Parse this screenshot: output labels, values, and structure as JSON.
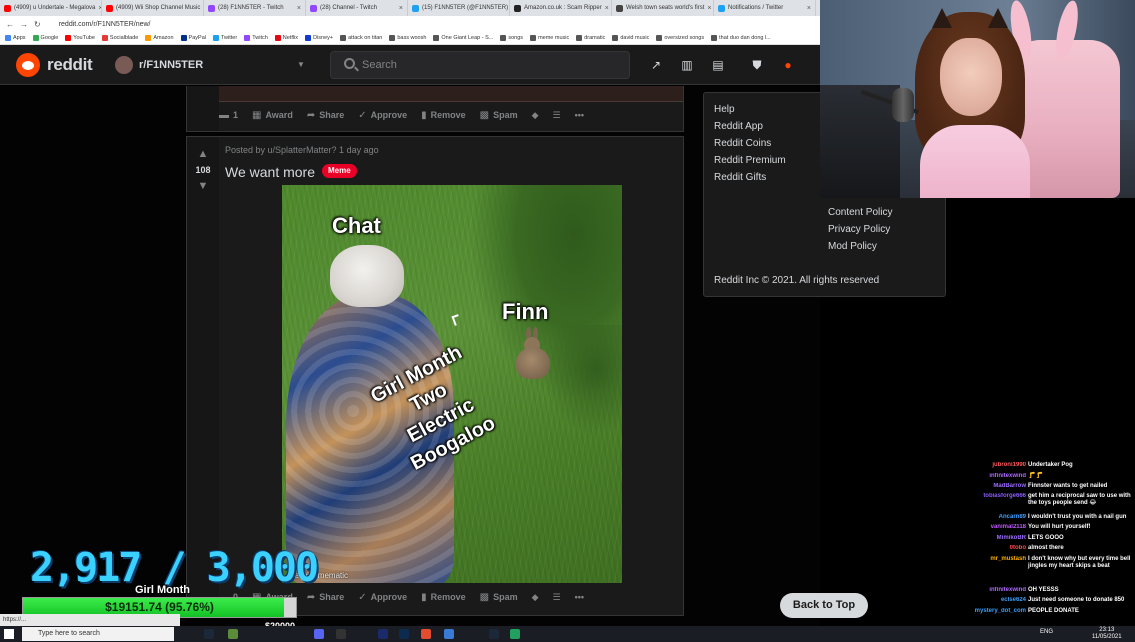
{
  "browser": {
    "tabs": [
      {
        "label": "(4909) u Undertale - Megalova",
        "color": "#ff0000"
      },
      {
        "label": "(4909) Wii Shop Channel Music",
        "color": "#ff0000"
      },
      {
        "label": "(28) F1NN5TER - Twitch",
        "color": "#9146ff"
      },
      {
        "label": "(28) Channel - Twitch",
        "color": "#9146ff"
      },
      {
        "label": "(15) F1NN5TER (@F1NN5TER)",
        "color": "#1da1f2"
      },
      {
        "label": "Amazon.co.uk : Scam Ripper",
        "color": "#222222"
      },
      {
        "label": "Welsh town seats world's first",
        "color": "#444444"
      },
      {
        "label": "Notifications / Twitter",
        "color": "#1da1f2"
      }
    ],
    "url": "reddit.com/r/F1NN5TER/new/",
    "bookmarks": [
      "Apps",
      "Google",
      "YouTube",
      "Socialblade",
      "Amazon",
      "PayPal",
      "Twitter",
      "Twitch",
      "Netflix",
      "Disney+",
      "attack on titan",
      "bass woosh",
      "One Giant Leap - S...",
      "songs",
      "meme music",
      "dramatic",
      "david music",
      "oversized songs",
      "that duo dan dong l..."
    ]
  },
  "reddit": {
    "wordmark": "reddit",
    "subreddit": "r/F1NN5TER",
    "search_placeholder": "Search",
    "card1": {
      "comments": "1",
      "actions": [
        "Award",
        "Share",
        "Approve",
        "Remove",
        "Spam"
      ]
    },
    "post": {
      "votes": "108",
      "meta": "Posted by u/SplatterMatter? 1 day ago",
      "title": "We want more",
      "flair": "Meme",
      "meme": {
        "top_label": "Chat",
        "right_label": "Finn",
        "center_lines": [
          "Girl Month",
          "Two",
          "Electric",
          "Boogaloo"
        ],
        "watermark": "...e with mematic"
      },
      "comments": "0",
      "actions": [
        "Award",
        "Share",
        "Approve",
        "Remove",
        "Spam"
      ]
    },
    "sidebar": {
      "links": [
        "Help",
        "Reddit App",
        "Reddit Coins",
        "Reddit Premium",
        "Reddit Gifts"
      ],
      "policies": [
        "Content Policy",
        "Privacy Policy",
        "Mod Policy"
      ],
      "copyright": "Reddit Inc © 2021. All rights reserved"
    },
    "back_to_top": "Back to Top"
  },
  "overlay": {
    "goal_count": "2,917 / 3,000",
    "goal_title": "Girl Month",
    "goal_amount": "$19151.74 (95.76%)",
    "goal_progress": 0.9576,
    "goal_max": "$20000",
    "status_url": "https://..."
  },
  "chat": [
    {
      "user": "jubroni1990",
      "msg": "Undertaker Pog",
      "color": "#ff5a5a"
    },
    {
      "user": "infinitexwind",
      "msg": "🦵🦵",
      "color": "#b06cff"
    },
    {
      "user": "MadBarrow",
      "msg": "Finnster wants to get nailed",
      "color": "#9b6bff"
    },
    {
      "user": "tobiasforge666",
      "msg": "get him a reciprocal saw to use with the toys people send 😂",
      "color": "#8a5cff"
    },
    {
      "user": "Ancarn89",
      "msg": "I wouldn't trust you with a nail gun",
      "color": "#3aa0ff"
    },
    {
      "user": "vanimal2118",
      "msg": "You will hurt yourself!",
      "color": "#c05aff"
    },
    {
      "user": "MimikoBR",
      "msg": "LETS GOOO",
      "color": "#9b6bff"
    },
    {
      "user": "0tobo",
      "msg": "almost there",
      "color": "#ff4b4b"
    },
    {
      "user": "mr_mustash",
      "msg": "I don't know why but every time bell jingles my heart skips a beat",
      "color": "#ffb000"
    },
    {
      "user": "infinitexwind",
      "msg": "OH YESSS",
      "color": "#b06cff"
    },
    {
      "user": "eclse624",
      "msg": "Just need someone to donate 850",
      "color": "#3aa0ff"
    },
    {
      "user": "mystery_dot_com",
      "msg": "PEOPLE DONATE",
      "color": "#3aa0ff"
    }
  ],
  "taskbar": {
    "search_placeholder": "Type here to search",
    "tray": "ENG",
    "time": "23:13",
    "date": "11/05/2021"
  }
}
